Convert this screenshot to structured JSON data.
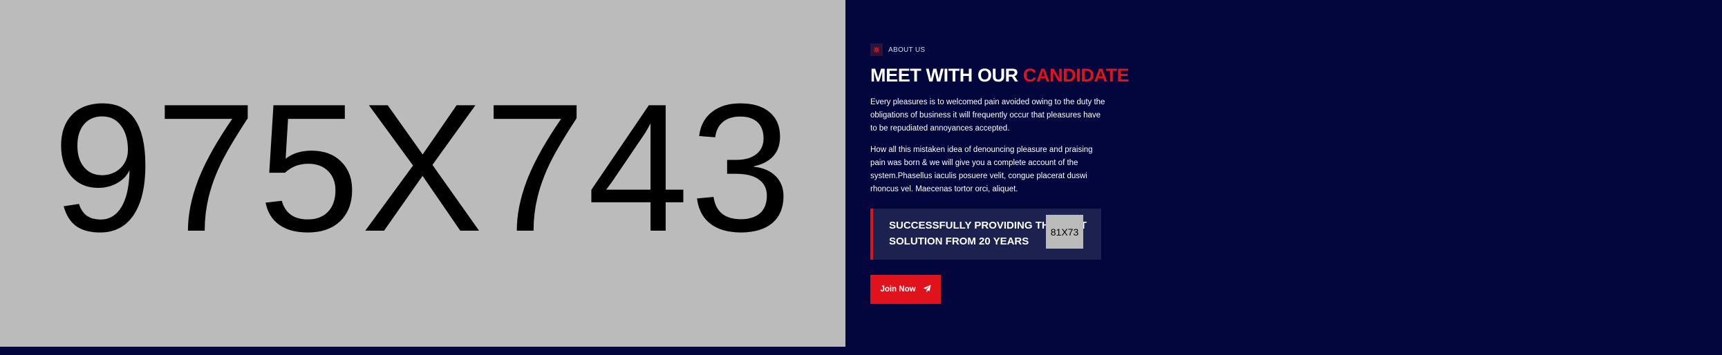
{
  "hero_image": {
    "placeholder_text": "975X743",
    "bg_color": "#bbbbbb"
  },
  "about": {
    "tag": {
      "icon": "gear-icon",
      "label": "ABOUT US"
    },
    "title": {
      "main": "MEET WITH OUR ",
      "accent": "CANDIDATE"
    },
    "paragraphs": [
      "Every pleasures is to welcomed pain avoided owing to the duty the obligations of business it will frequently occur that pleasures have to be repudiated annoyances accepted.",
      "How all this mistaken idea of denouncing pleasure and praising pain was born & we will give you a complete account of the system.Phasellus iaculis posuere velit, congue placerat duswi rhoncus vel. Maecenas tortor orci, aliquet."
    ],
    "highlight": {
      "text": "SUCCESSFULLY PROVIDING THE BEST SOLUTION FROM 20 YEARS",
      "image_placeholder": "81X73"
    },
    "button": {
      "label": "Join Now",
      "icon": "paper-plane-icon"
    }
  },
  "colors": {
    "background": "#03063d",
    "accent": "#e0121c",
    "panel": "#1d2150",
    "text": "#ffffff"
  }
}
